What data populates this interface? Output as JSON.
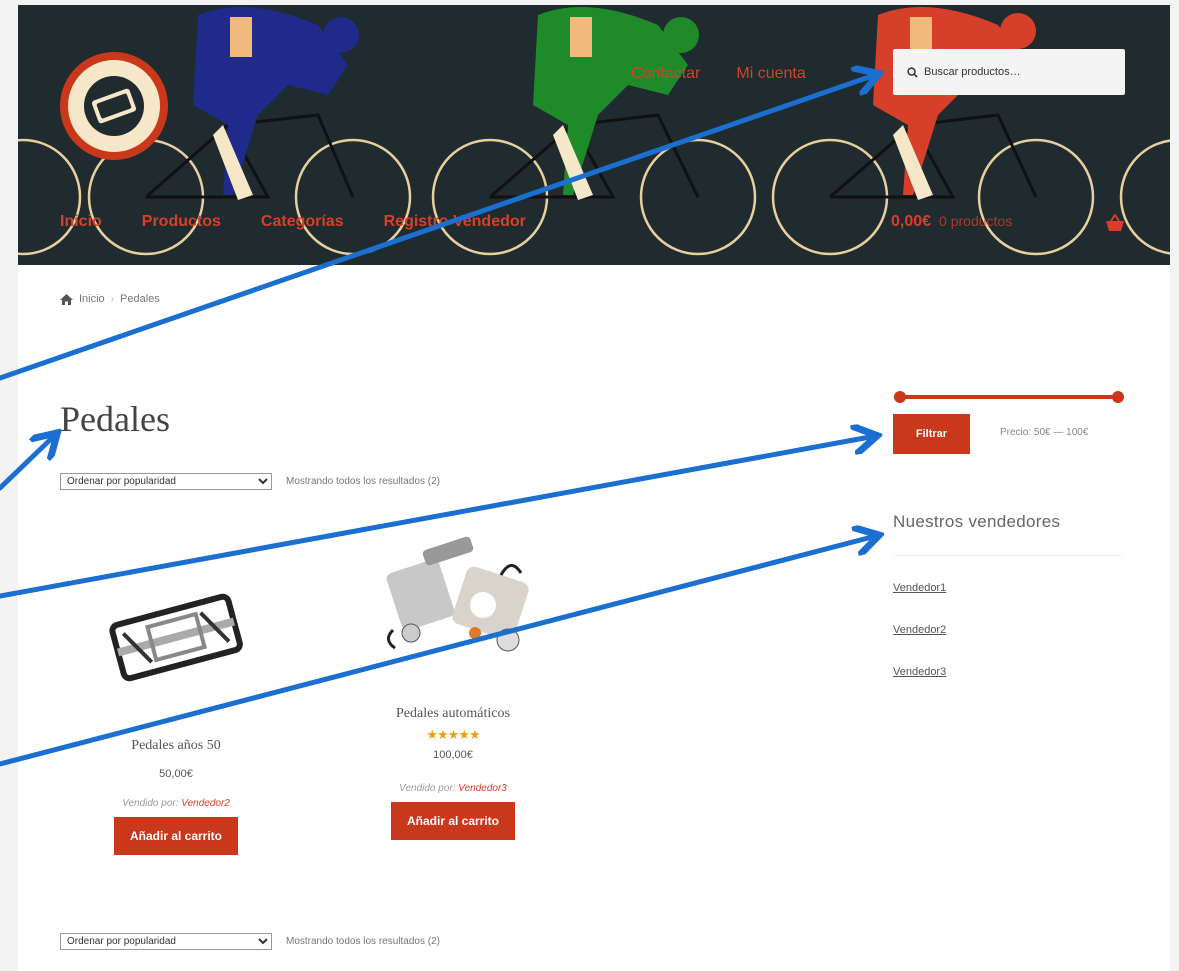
{
  "header": {
    "top_nav": [
      "Contactar",
      "Mi cuenta"
    ],
    "search_placeholder": "Buscar productos…",
    "main_nav": [
      "Inicio",
      "Productos",
      "Categorías",
      "Registro Vendedor"
    ],
    "cart_amount": "0,00€",
    "cart_count": "0 productos",
    "icons": [
      "search-icon",
      "basket-icon",
      "logo"
    ],
    "colors": {
      "header_bg": "#1f2b2e",
      "accent": "#d6402a"
    }
  },
  "breadcrumb": {
    "home": "Inicio",
    "current": "Pedales"
  },
  "main": {
    "title": "Pedales",
    "sort_option": "Ordenar por popularidad",
    "results_text": "Mostrando todos los resultados (2)",
    "products": [
      {
        "name": "Pedales años 50",
        "price": "50,00€",
        "vendor_label": "Vendido por:",
        "vendor": "Vendedor2",
        "button": "Añadir al carrito"
      },
      {
        "name": "Pedales automáticos",
        "rating_stars": "★★★★★",
        "price": "100,00€",
        "vendor_label": "Vendido por:",
        "vendor": "Vendedor3",
        "button": "Añadir al carrito"
      }
    ]
  },
  "sidebar": {
    "filter_button": "Filtrar",
    "price_range": "Precio: 50€ — 100€",
    "vendors_title": "Nuestros vendedores",
    "vendors": [
      "Vendedor1",
      "Vendedor2",
      "Vendedor3"
    ]
  }
}
